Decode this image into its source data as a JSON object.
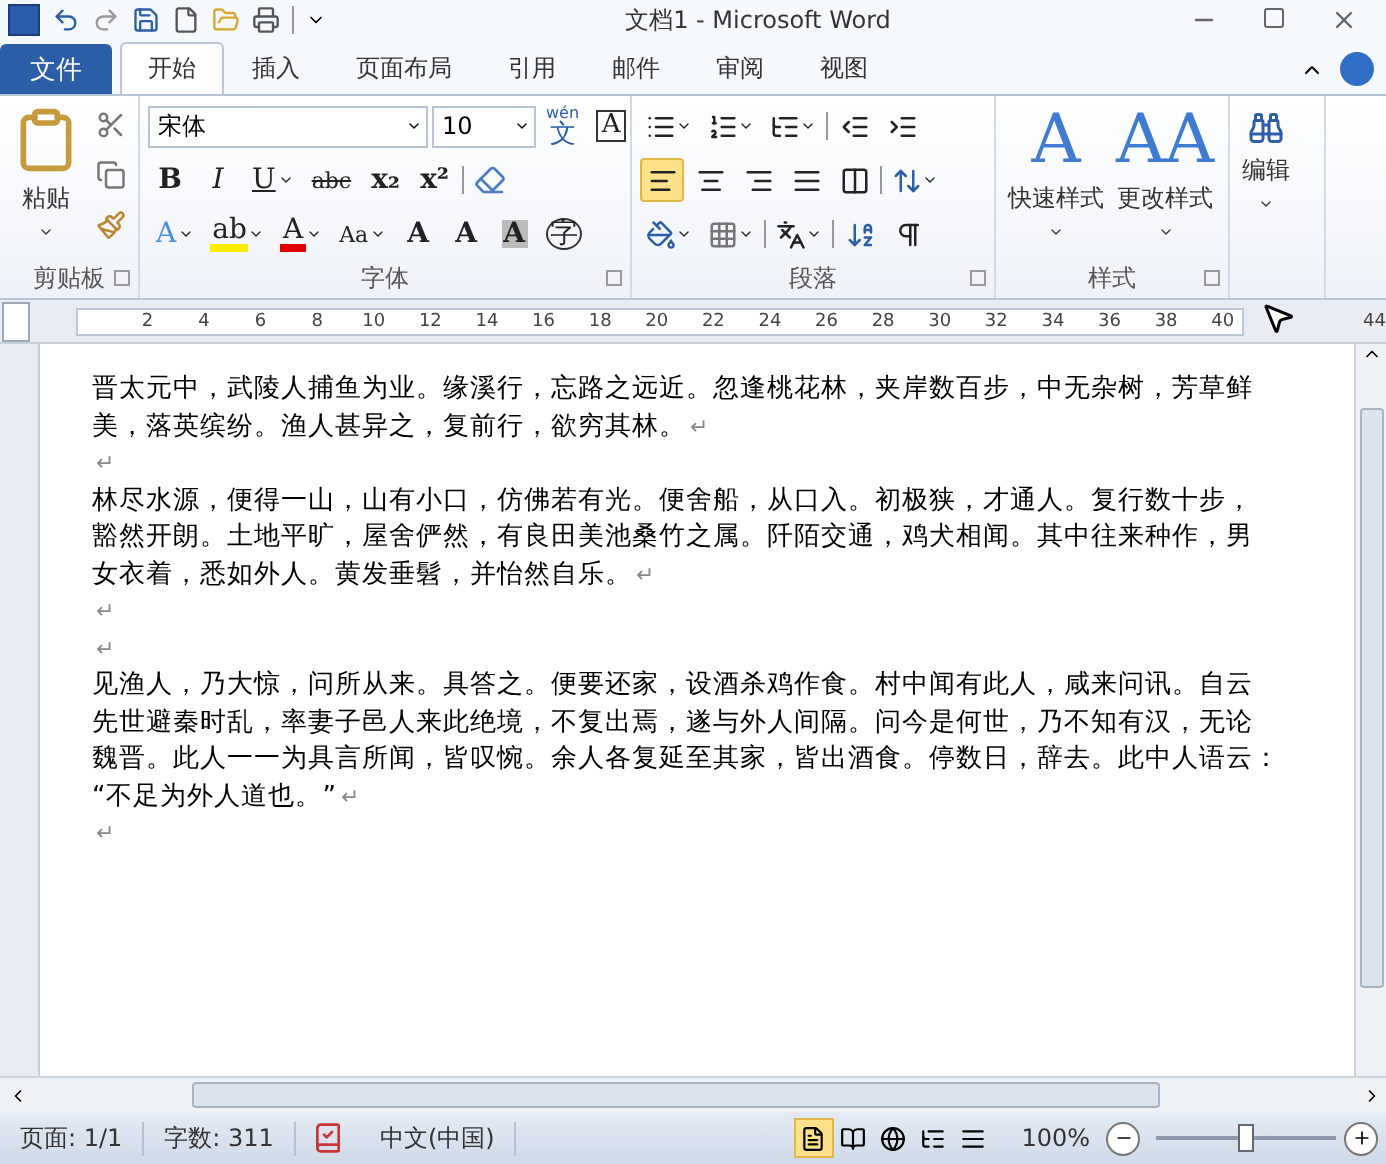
{
  "window": {
    "title": "文档1  -  Microsoft Word"
  },
  "tabs": [
    {
      "label": "文件",
      "kind": "file",
      "selected": false
    },
    {
      "label": "开始",
      "kind": "tab",
      "selected": true
    },
    {
      "label": "插入",
      "kind": "tab",
      "selected": false
    },
    {
      "label": "页面布局",
      "kind": "tab",
      "selected": false
    },
    {
      "label": "引用",
      "kind": "tab",
      "selected": false
    },
    {
      "label": "邮件",
      "kind": "tab",
      "selected": false
    },
    {
      "label": "审阅",
      "kind": "tab",
      "selected": false
    },
    {
      "label": "视图",
      "kind": "tab",
      "selected": false
    }
  ],
  "ribbon": {
    "clipboard": {
      "label": "剪贴板",
      "paste": "粘贴"
    },
    "font": {
      "label": "字体",
      "font_name": "宋体",
      "font_size": "10",
      "phonetic": {
        "ruby": "wén",
        "label": "文"
      },
      "border_char": "A",
      "format_buttons": [
        {
          "kind": "bold",
          "label": "B",
          "dropdown": false
        },
        {
          "kind": "italic",
          "label": "I",
          "dropdown": false
        },
        {
          "kind": "underline",
          "label": "U",
          "dropdown": true
        },
        {
          "kind": "strike",
          "label": "abc",
          "dropdown": false
        },
        {
          "kind": "subscript",
          "label": "x₂",
          "dropdown": false
        },
        {
          "kind": "superscript",
          "label": "x²",
          "dropdown": false
        }
      ],
      "effect_buttons": [
        {
          "kind": "effects",
          "label": "A",
          "dropdown": true
        },
        {
          "kind": "highlight",
          "label": "ab",
          "dropdown": true
        },
        {
          "kind": "color",
          "label": "A",
          "dropdown": true
        },
        {
          "kind": "case",
          "label": "Aa",
          "dropdown": true
        },
        {
          "kind": "grow",
          "label": "A",
          "dropdown": false
        },
        {
          "kind": "shrink",
          "label": "A",
          "dropdown": false
        },
        {
          "kind": "shading",
          "label": "A",
          "dropdown": false
        },
        {
          "kind": "enclose",
          "label": "字",
          "dropdown": false
        }
      ]
    },
    "paragraph": {
      "label": "段落",
      "alignment": [
        {
          "kind": "left",
          "selected": true
        },
        {
          "kind": "center",
          "selected": false
        },
        {
          "kind": "right",
          "selected": false
        },
        {
          "kind": "justify",
          "selected": false
        },
        {
          "kind": "distributed",
          "selected": false
        }
      ]
    },
    "styles": {
      "label": "样式",
      "buttons": [
        {
          "label": "快速样式",
          "glyph": "A"
        },
        {
          "label": "更改样式",
          "glyph": "AA"
        }
      ]
    },
    "editing": {
      "label": "编辑"
    }
  },
  "ruler": {
    "numbers": [
      "2",
      "4",
      "6",
      "8",
      "10",
      "12",
      "14",
      "16",
      "18",
      "20",
      "22",
      "24",
      "26",
      "28",
      "30",
      "32",
      "34",
      "36",
      "38",
      "40",
      "44"
    ]
  },
  "document": {
    "paragraphs": [
      {
        "lines": [
          "晋太元中，武陵人捕鱼为业。缘溪行，忘路之远近。忽逢桃花林，夹岸数百步，中无杂树，芳草鲜",
          "美，落英缤纷。渔人甚异之，复前行，欲穷其林。"
        ],
        "mark": "↵"
      },
      {
        "mark": "↵"
      },
      {
        "lines": [
          "林尽水源，便得一山，山有小口，仿佛若有光。便舍船，从口入。初极狭，才通人。复行数十步，",
          "豁然开朗。土地平旷，屋舍俨然，有良田美池桑竹之属。阡陌交通，鸡犬相闻。其中往来种作，男",
          "女衣着，悉如外人。黄发垂髫，并怡然自乐。"
        ],
        "mark": "↵"
      },
      {
        "mark": "↵"
      },
      {
        "mark": "↵"
      },
      {
        "lines": [
          "见渔人，乃大惊，问所从来。具答之。便要还家，设酒杀鸡作食。村中闻有此人，咸来问讯。自云",
          "先世避秦时乱，率妻子邑人来此绝境，不复出焉，遂与外人间隔。问今是何世，乃不知有汉，无论",
          "魏晋。此人一一为具言所闻，皆叹惋。余人各复延至其家，皆出酒食。停数日，辞去。此中人语云：",
          "“不足为外人道也。”"
        ],
        "mark": "↵"
      },
      {
        "mark": "↵"
      }
    ]
  },
  "status_bar": {
    "page": "页面: 1/1",
    "words": "字数: 311",
    "language": "中文(中国)",
    "views": [
      {
        "kind": "print",
        "selected": true
      },
      {
        "kind": "reading",
        "selected": false
      },
      {
        "kind": "web",
        "selected": false
      },
      {
        "kind": "outline",
        "selected": false
      },
      {
        "kind": "draft",
        "selected": false
      }
    ],
    "zoom": "100%",
    "zoom_slider": {
      "level": 0.5
    }
  }
}
